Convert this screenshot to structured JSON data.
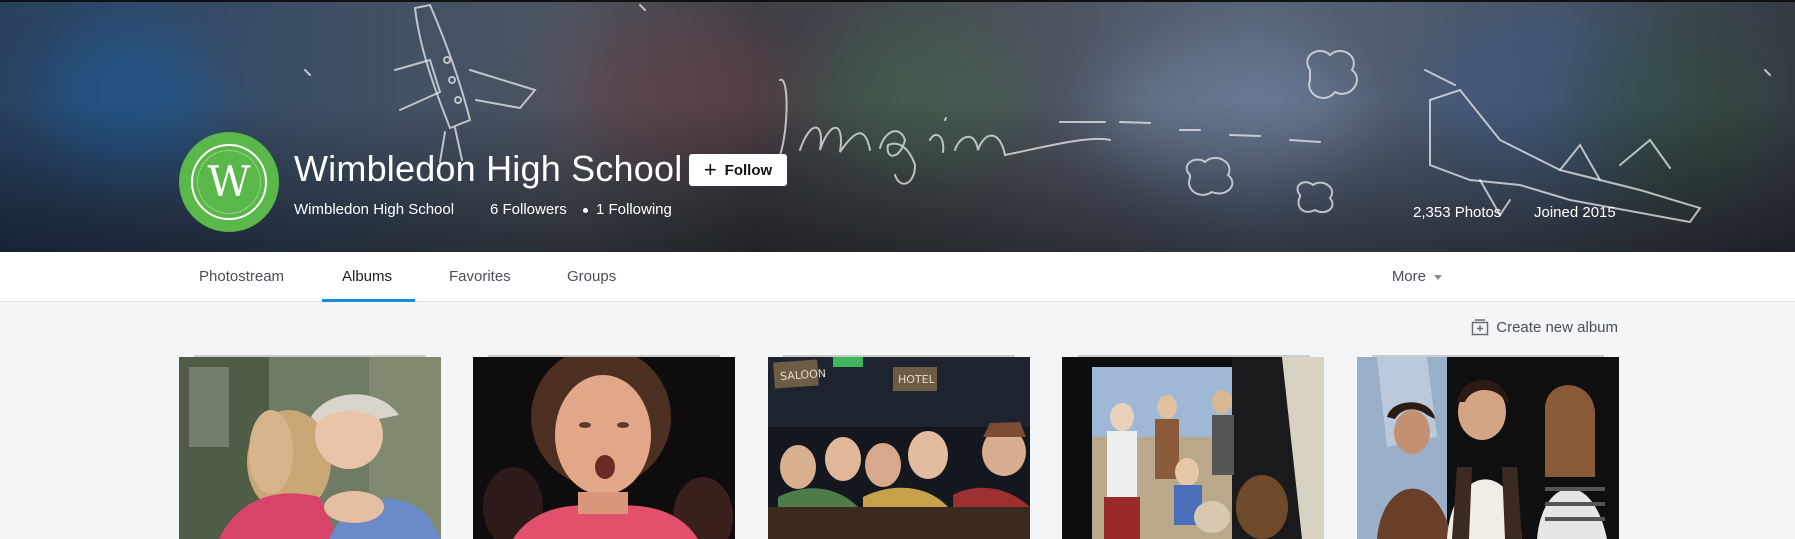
{
  "profile": {
    "name": "Wimbledon High School",
    "avatar_letter": "W",
    "real_name": "Wimbledon High School",
    "followers": "6 Followers",
    "following": "1 Following",
    "photos": "2,353 Photos",
    "joined": "Joined 2015",
    "follow_label": "Follow",
    "cover_text": "Imagine"
  },
  "nav": {
    "tabs": [
      {
        "label": "Photostream"
      },
      {
        "label": "Albums"
      },
      {
        "label": "Favorites"
      },
      {
        "label": "Groups"
      }
    ],
    "active_tab": "Albums",
    "more_label": "More"
  },
  "actions": {
    "create_album_label": "Create new album"
  },
  "colors": {
    "accent": "#128fdc",
    "avatar_bg": "#5ab749"
  },
  "albums": [
    {
      "scene": "hug"
    },
    {
      "scene": "singer"
    },
    {
      "scene": "saloon"
    },
    {
      "scene": "stage-play"
    },
    {
      "scene": "costumes"
    }
  ],
  "cover_signs": {
    "saloon": "SALOON",
    "hotel": "HOTEL"
  }
}
